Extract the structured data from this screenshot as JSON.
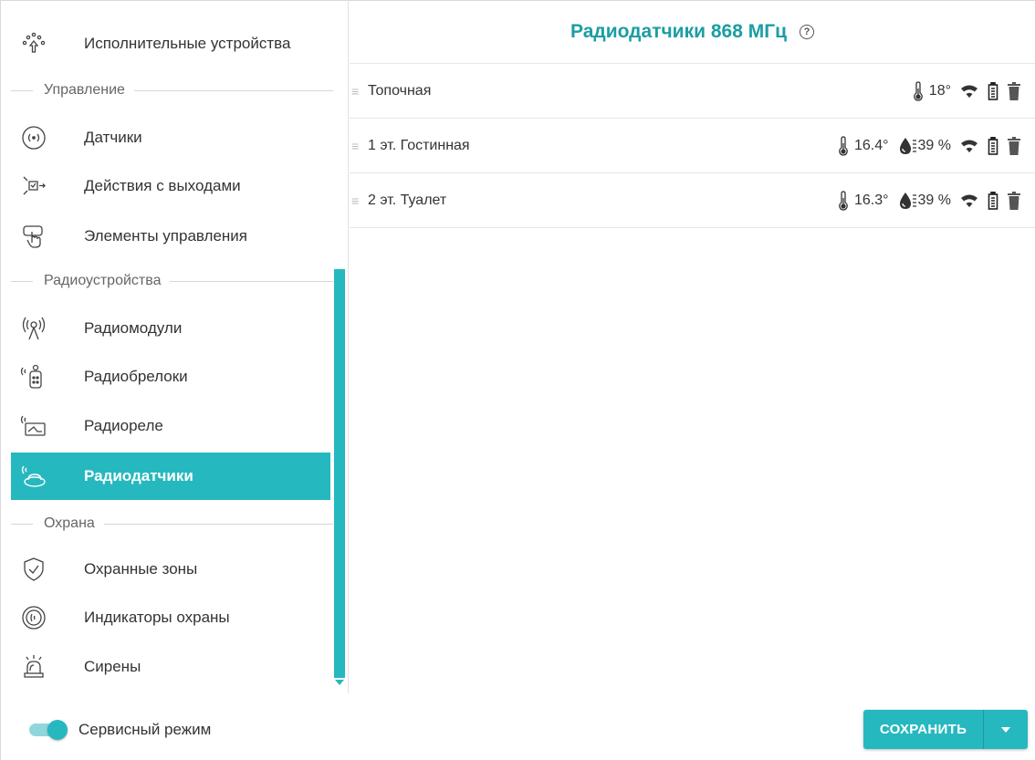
{
  "sidebar": {
    "top_item": {
      "label": "Исполнительные устройства",
      "icon": "actuators-icon"
    },
    "sections": [
      {
        "title": "Управление",
        "items": [
          {
            "label": "Датчики",
            "icon": "sensor-icon"
          },
          {
            "label": "Действия с выходами",
            "icon": "output-actions-icon"
          },
          {
            "label": "Элементы управления",
            "icon": "touch-controls-icon"
          }
        ]
      },
      {
        "title": "Радиоустройства",
        "items": [
          {
            "label": "Радиомодули",
            "icon": "radio-antenna-icon"
          },
          {
            "label": "Радиобрелоки",
            "icon": "key-fob-icon"
          },
          {
            "label": "Радиореле",
            "icon": "radio-relay-icon"
          },
          {
            "label": "Радиодатчики",
            "icon": "radio-sensor-icon",
            "active": true
          }
        ]
      },
      {
        "title": "Охрана",
        "items": [
          {
            "label": "Охранные зоны",
            "icon": "shield-icon"
          },
          {
            "label": "Индикаторы охраны",
            "icon": "security-indicator-icon"
          },
          {
            "label": "Сирены",
            "icon": "siren-icon"
          }
        ]
      }
    ]
  },
  "main": {
    "title": "Радиодатчики 868 МГц",
    "help": "?",
    "rows": [
      {
        "name": "Топочная",
        "temperature": "18°",
        "humidity": ""
      },
      {
        "name": "1 эт. Гостинная",
        "temperature": "16.4°",
        "humidity": "39 %"
      },
      {
        "name": "2 эт. Туалет",
        "temperature": "16.3°",
        "humidity": "39 %"
      }
    ]
  },
  "footer": {
    "service_mode_label": "Сервисный режим",
    "service_mode_on": true,
    "save_label": "СОХРАНИТЬ"
  },
  "colors": {
    "accent": "#26b8bf",
    "title": "#1a9ea3"
  }
}
